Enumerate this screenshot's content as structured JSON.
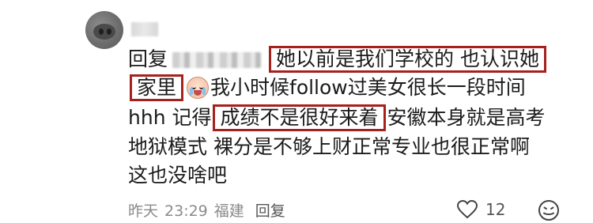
{
  "reply_label": "回复",
  "line1_highlight": "她以前是我们学校的 也认识她",
  "line2_highlight": "家里",
  "line2_rest": "我小时候follow过美女很长一段时间",
  "line3_start": "hhh 记得",
  "line3_highlight": "成绩不是很好来着",
  "line3_rest": "安徽本身就是高考",
  "line4": "地狱模式 裸分是不够上财正常专业也很正常啊",
  "line5": "这也没啥吧",
  "meta": {
    "date": "昨天",
    "time": "23:29",
    "location": "福建",
    "reply": "回复"
  },
  "like_count": "12",
  "colors": {
    "highlight_border": "#a5211e",
    "meta_text": "#8a8a8a"
  },
  "icons": [
    "avatar",
    "crying-emoji-icon",
    "heart-icon",
    "emoji-icon"
  ]
}
